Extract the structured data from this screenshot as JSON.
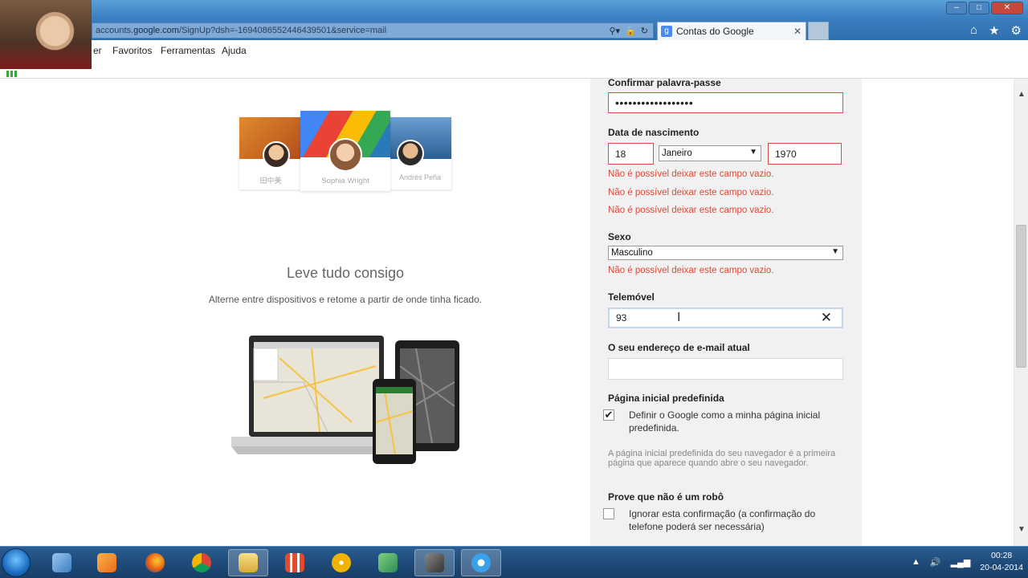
{
  "browser": {
    "url_prefix": "accounts.",
    "url_domain": "google.com",
    "url_rest": "/SignUp?dsh=-1694086552446439501&service=mail",
    "tab_title": "Contas do Google",
    "tab_favicon": "g",
    "menu": [
      "er",
      "Favoritos",
      "Ferramentas",
      "Ajuda"
    ],
    "window_controls": [
      "–",
      "□",
      "✕"
    ]
  },
  "promo": {
    "people": [
      "田中美",
      "Sophia Wright",
      "Andrés Peña"
    ],
    "title": "Leve tudo consigo",
    "subtitle": "Alterne entre dispositivos e retome a partir de onde tinha ficado."
  },
  "form": {
    "confirm_password_label": "Confirmar palavra-passe",
    "confirm_password_value": "••••••••••••••••••",
    "birthdate_label": "Data de nascimento",
    "birth_day": "18",
    "birth_month": "Janeiro",
    "birth_year": "1970",
    "error_empty": "Não é possível deixar este campo vazio.",
    "gender_label": "Sexo",
    "gender_value": "Masculino",
    "phone_label": "Telemóvel",
    "phone_value": "93",
    "email_label": "O seu endereço de e-mail atual",
    "email_value": "",
    "homepage_label": "Página inicial predefinida",
    "homepage_checkbox": "Definir o Google como a minha página inicial predefinida.",
    "homepage_checked": true,
    "homepage_help": "A página inicial predefinida do seu navegador é a primeira página que aparece quando abre o seu navegador.",
    "robot_label": "Prove que não é um robô",
    "robot_checkbox": "Ignorar esta confirmação (a confirmação do telefone poderá ser necessária)",
    "robot_checked": false
  },
  "taskbar": {
    "time": "00:28",
    "date": "20-04-2014"
  }
}
